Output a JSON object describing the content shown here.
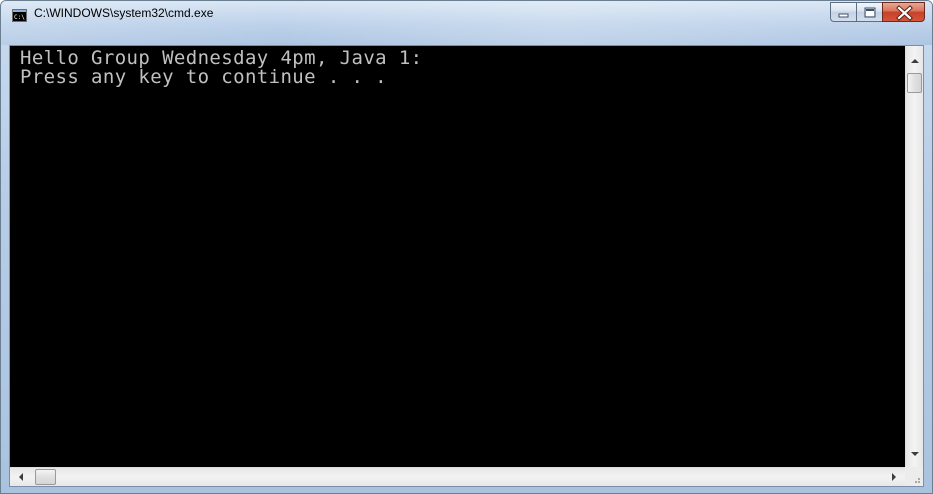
{
  "window": {
    "title": "C:\\WINDOWS\\system32\\cmd.exe",
    "app_icon": "cmd-icon",
    "close_color": "#c8412a"
  },
  "console": {
    "lines": [
      "Hello Group Wednesday 4pm, Java 1:",
      "Press any key to continue . . ."
    ],
    "foreground": "#c0c0c0",
    "background": "#000000"
  },
  "caption_buttons": {
    "minimize_icon": "minimize-icon",
    "maximize_icon": "maximize-icon",
    "close_icon": "close-icon"
  },
  "scrollbars": {
    "vertical_position": 0,
    "horizontal_position": 0
  }
}
